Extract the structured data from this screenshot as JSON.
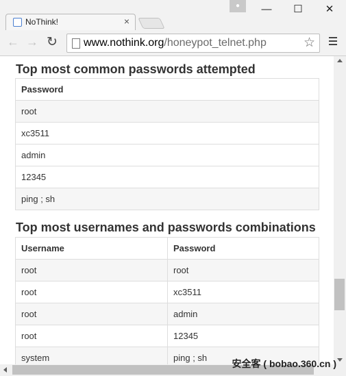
{
  "browser": {
    "tab_title": "NoThink!",
    "tab_close": "×",
    "window_minimize": "—",
    "window_maximize": "☐",
    "window_close": "✕",
    "back_icon": "←",
    "forward_icon": "→",
    "reload_icon": "↻",
    "url_domain": "www.nothink.org",
    "url_path": "/honeypot_telnet.php",
    "star_icon": "☆"
  },
  "passwords_section": {
    "heading": "Top most common passwords attempted",
    "column": "Password",
    "rows": [
      "root",
      "xc3511",
      "admin",
      "12345",
      "ping ; sh"
    ]
  },
  "combos_section": {
    "heading": "Top most usernames and passwords combinations",
    "columns": [
      "Username",
      "Password"
    ],
    "rows": [
      [
        "root",
        "root"
      ],
      [
        "root",
        "xc3511"
      ],
      [
        "root",
        "admin"
      ],
      [
        "root",
        "12345"
      ],
      [
        "system",
        "ping ; sh"
      ]
    ]
  },
  "watermark": "安全客 ( bobao.360.cn )"
}
